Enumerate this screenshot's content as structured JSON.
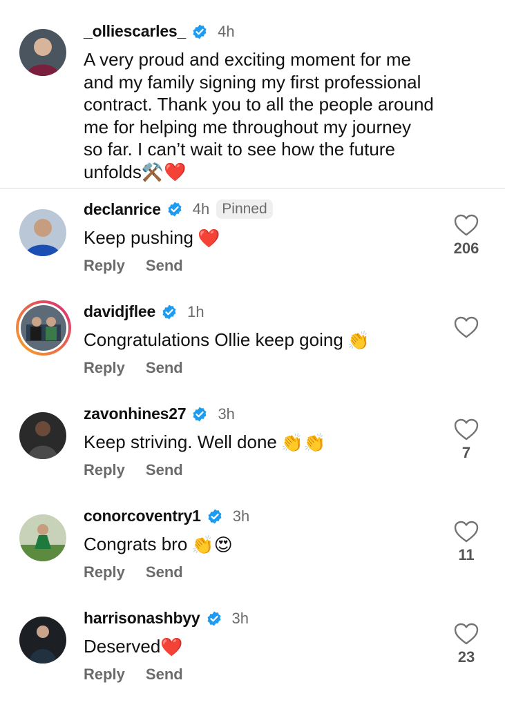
{
  "caption": {
    "username": "_olliescarles_",
    "time": "4h",
    "text": "A very proud and exciting moment for me\nand my family signing my first professional\ncontract.  Thank you to all the people around\nme for helping me throughout my journey\nso far. I can’t wait to see how the future\nunfolds",
    "emojis": "⚒️❤️"
  },
  "comments": [
    {
      "username": "declanrice",
      "time": "4h",
      "pinned": "Pinned",
      "text": "Keep pushing",
      "emoji": "❤️",
      "likes": "206",
      "reply": "Reply",
      "send": "Send"
    },
    {
      "username": "davidjflee",
      "time": "1h",
      "text": "Congratulations Ollie keep going",
      "emoji": "👏",
      "likes": "",
      "reply": "Reply",
      "send": "Send"
    },
    {
      "username": "zavonhines27",
      "time": "3h",
      "text": "Keep striving. Well done",
      "emoji": "👏👏",
      "likes": "7",
      "reply": "Reply",
      "send": "Send"
    },
    {
      "username": "conorcoventry1",
      "time": "3h",
      "text": "Congrats bro",
      "emoji": "👏😍",
      "likes": "11",
      "reply": "Reply",
      "send": "Send"
    },
    {
      "username": "harrisonashbyy",
      "time": "3h",
      "text": "Deserved",
      "emoji": "❤️",
      "likes": "23",
      "reply": "Reply",
      "send": "Send"
    }
  ],
  "icons": {
    "verified": "verified-badge-icon",
    "like": "heart-outline-icon"
  },
  "colors": {
    "verified_blue": "#1d9bf0",
    "secondary_text": "#6b6b6b",
    "story_ring_start": "#f9a825",
    "story_ring_end": "#d62976"
  }
}
